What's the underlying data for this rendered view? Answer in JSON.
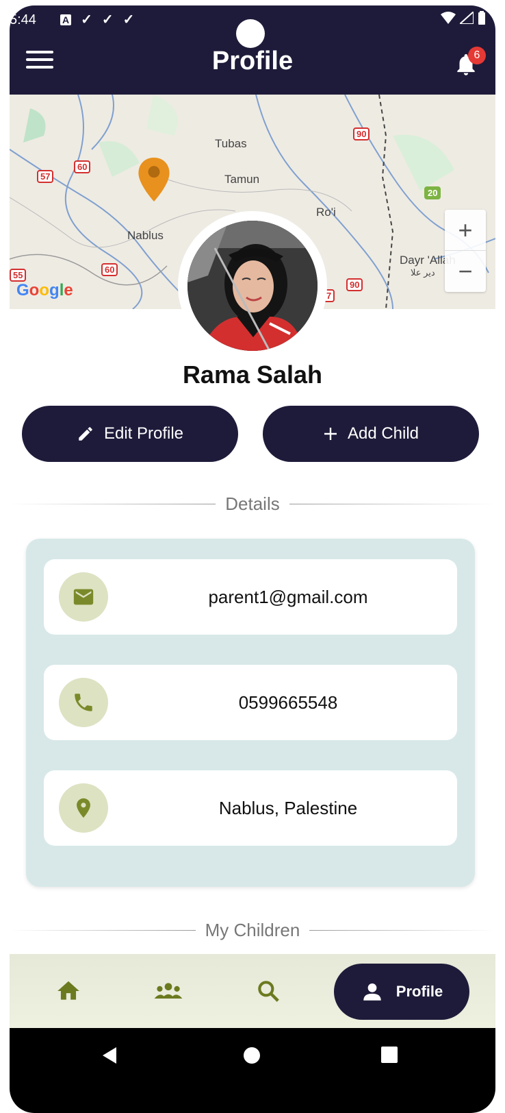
{
  "status_bar": {
    "time": "5:44",
    "icons": [
      "A",
      "✓",
      "✓",
      "✓"
    ],
    "right_icons": [
      "wifi-icon",
      "signal-icon",
      "battery-icon"
    ]
  },
  "header": {
    "title": "Profile",
    "notification_count": "6"
  },
  "map": {
    "labels": [
      "Tubas",
      "Tamun",
      "Nablus",
      "Ro'i",
      "Dayr 'Allah",
      "دير علا"
    ],
    "road_signs": [
      "57",
      "60",
      "90",
      "20",
      "60",
      "55",
      "90",
      "7"
    ],
    "attribution": "Google",
    "zoom_in": "+",
    "zoom_out": "−"
  },
  "profile": {
    "name": "Rama Salah",
    "edit_label": "Edit Profile",
    "add_child_label": "Add Child"
  },
  "details": {
    "heading": "Details",
    "email": "parent1@gmail.com",
    "phone": "0599665548",
    "location": "Nablus, Palestine"
  },
  "children": {
    "heading": "My Children"
  },
  "bottom_nav": {
    "items": [
      {
        "icon": "home-icon"
      },
      {
        "icon": "group-icon"
      },
      {
        "icon": "search-icon"
      }
    ],
    "active_label": "Profile"
  },
  "colors": {
    "primary": "#1e1b3a",
    "card_bg": "#d8e8e8",
    "icon_circle": "#dde2c2",
    "icon_color": "#7a8a2a",
    "badge": "#e53935"
  }
}
